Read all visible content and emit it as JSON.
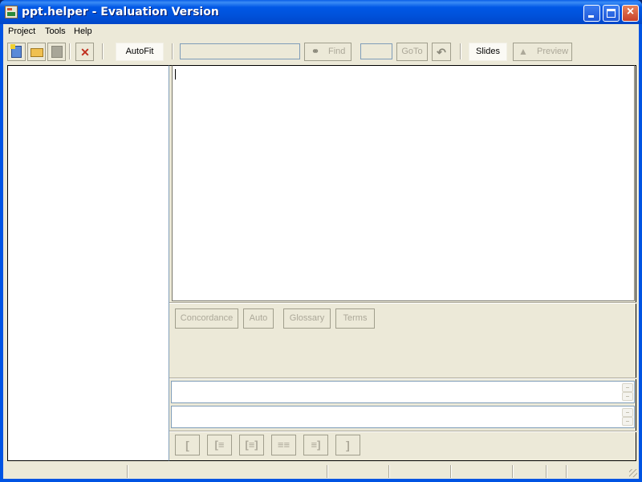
{
  "window": {
    "title": "ppt.helper - Evaluation Version",
    "controls": {
      "minimize": "minimize",
      "maximize": "maximize",
      "close": "×"
    }
  },
  "menu": {
    "items": [
      {
        "label": "Project"
      },
      {
        "label": "Tools"
      },
      {
        "label": "Help"
      }
    ]
  },
  "toolbar": {
    "new_project_icon": "new-project-icon",
    "open_icon": "open-folder-icon",
    "save_icon": "save-icon",
    "tools_icon": "tools-icon",
    "autofit_label": "AutoFit",
    "search_value": "",
    "find_label": "Find",
    "goto_value": "",
    "goto_label": "GoTo",
    "undo_icon": "undo-icon",
    "slides_label": "Slides",
    "preview_label": "Preview"
  },
  "editor": {
    "text": ""
  },
  "tabs": {
    "buttons": [
      {
        "label": "Concordance"
      },
      {
        "label": "Auto"
      },
      {
        "label": "Glossary"
      },
      {
        "label": "Terms"
      }
    ]
  },
  "source_box": {
    "value": ""
  },
  "target_box": {
    "value": ""
  },
  "segment_buttons": [
    {
      "icon": "segment-first-icon"
    },
    {
      "icon": "segment-previous-icon"
    },
    {
      "icon": "segment-copy-previous-icon"
    },
    {
      "icon": "segment-copy-next-icon"
    },
    {
      "icon": "segment-next-icon"
    },
    {
      "icon": "segment-last-icon"
    }
  ],
  "statusbar": {
    "sections": [
      "",
      "",
      "",
      "",
      "",
      "",
      ""
    ]
  }
}
